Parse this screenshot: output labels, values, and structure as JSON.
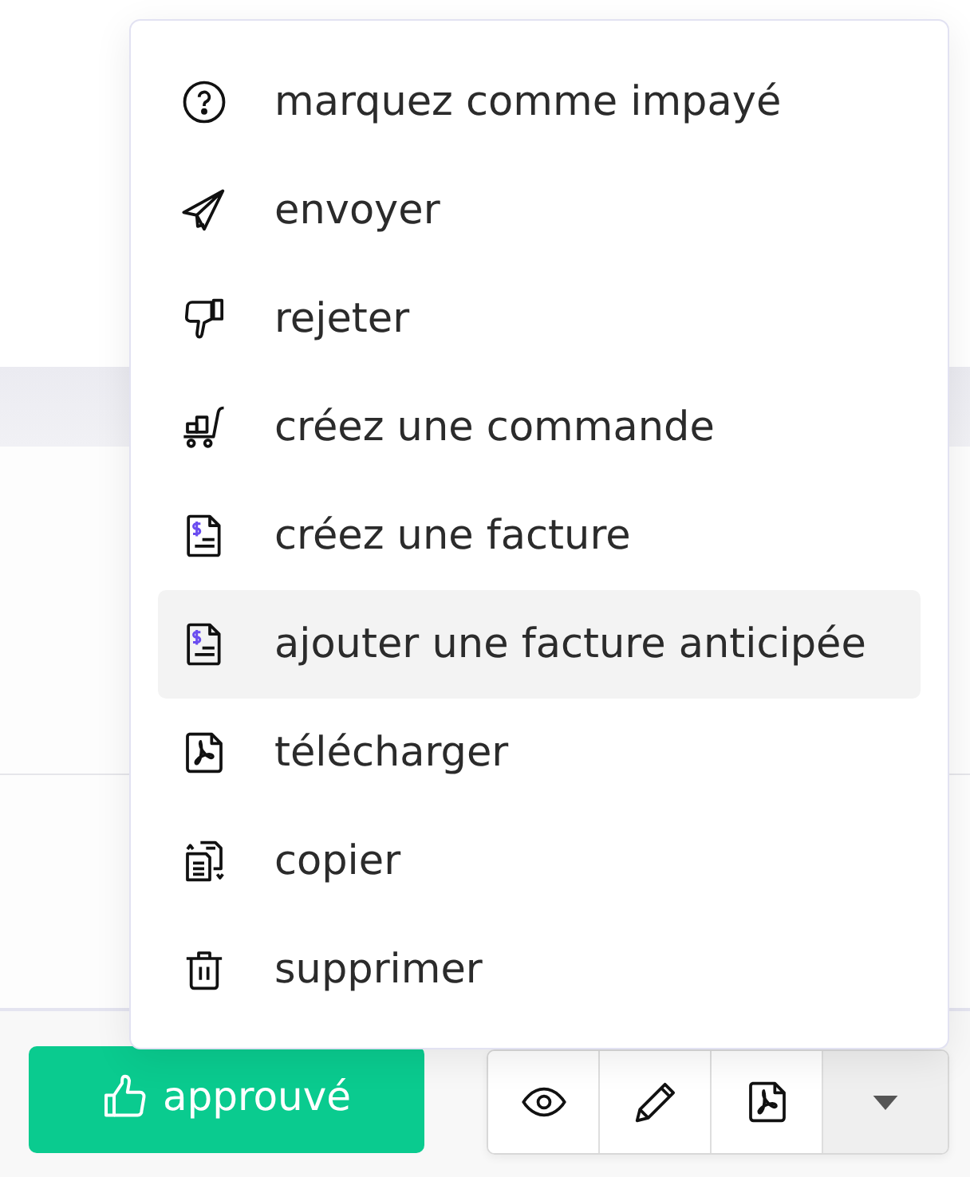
{
  "menu": {
    "items": [
      {
        "kind": "unpaid",
        "label": "marquez comme impayé",
        "selected": false
      },
      {
        "kind": "send",
        "label": "envoyer",
        "selected": false
      },
      {
        "kind": "reject",
        "label": "rejeter",
        "selected": false
      },
      {
        "kind": "order",
        "label": "créez une commande",
        "selected": false
      },
      {
        "kind": "invoice",
        "label": "créez une facture",
        "selected": false
      },
      {
        "kind": "advance_invoice",
        "label": "ajouter une facture anticipée",
        "selected": true
      },
      {
        "kind": "download",
        "label": "télécharger",
        "selected": false
      },
      {
        "kind": "copy",
        "label": "copier",
        "selected": false
      },
      {
        "kind": "delete",
        "label": "supprimer",
        "selected": false
      }
    ]
  },
  "footer": {
    "approve_button": {
      "label": "approuvé"
    },
    "tool_buttons": [
      {
        "kind": "view"
      },
      {
        "kind": "edit"
      },
      {
        "kind": "pdf"
      }
    ],
    "menu_toggle": {
      "expanded": true
    }
  }
}
